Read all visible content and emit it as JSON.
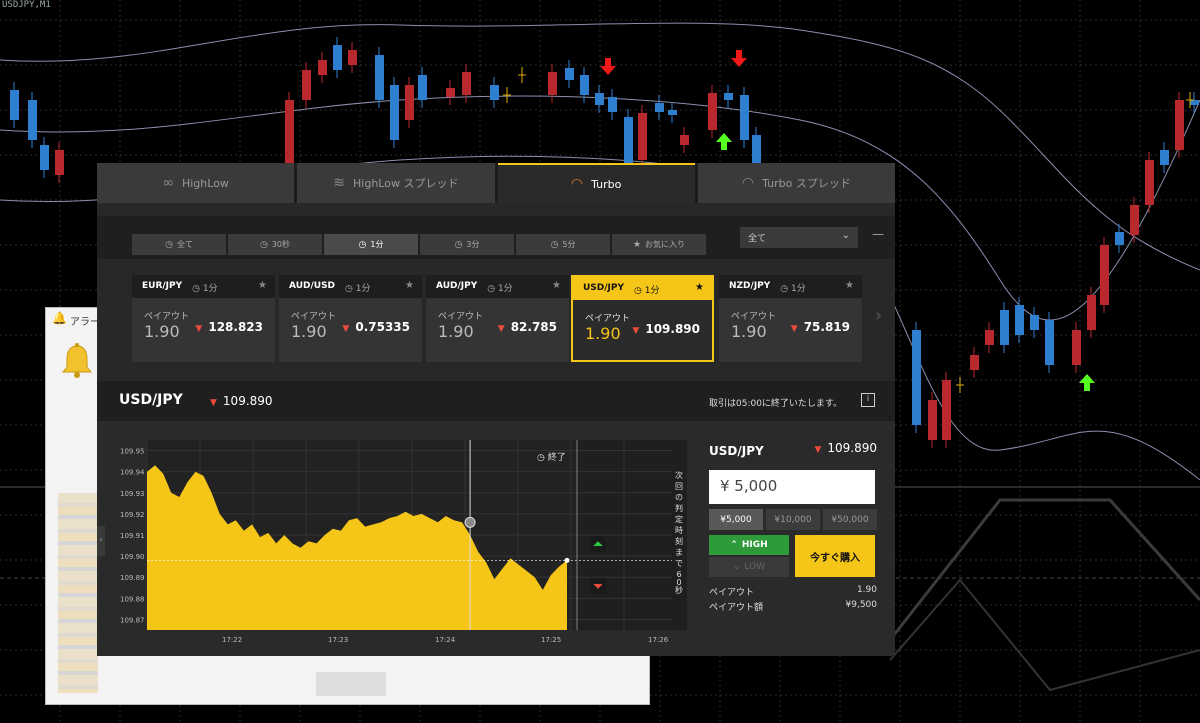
{
  "mt_chart": {
    "symbol_label": "USDJPY,M1"
  },
  "alert_window": {
    "title": "アラー"
  },
  "top_tabs": [
    {
      "label": "HighLow",
      "icon": "highlow-icon",
      "active": false
    },
    {
      "label": "HighLow スプレッド",
      "icon": "highlow-spread-icon",
      "active": false
    },
    {
      "label": "Turbo",
      "icon": "speedometer-icon",
      "active": true
    },
    {
      "label": "Turbo スプレッド",
      "icon": "speedometer-icon",
      "active": false
    }
  ],
  "filters": [
    {
      "label": "全て",
      "icon": "clock-icon"
    },
    {
      "label": "30秒",
      "icon": "clock-icon"
    },
    {
      "label": "1分",
      "icon": "clock-icon",
      "active": true
    },
    {
      "label": "3分",
      "icon": "clock-icon"
    },
    {
      "label": "5分",
      "icon": "clock-icon"
    },
    {
      "label": "お気に入り",
      "icon": "star-icon"
    }
  ],
  "asset_select": {
    "value": "全て"
  },
  "asset_cards": [
    {
      "pair": "EUR/JPY",
      "duration": "1分",
      "payout_label": "ペイアウト",
      "payout": "1.90",
      "price": "128.823"
    },
    {
      "pair": "AUD/USD",
      "duration": "1分",
      "payout_label": "ペイアウト",
      "payout": "1.90",
      "price": "0.75335"
    },
    {
      "pair": "AUD/JPY",
      "duration": "1分",
      "payout_label": "ペイアウト",
      "payout": "1.90",
      "price": "82.785"
    },
    {
      "pair": "USD/JPY",
      "duration": "1分",
      "payout_label": "ペイアウト",
      "payout": "1.90",
      "price": "109.890",
      "selected": true
    },
    {
      "pair": "NZD/JPY",
      "duration": "1分",
      "payout_label": "ペイアウト",
      "payout": "1.90",
      "price": "75.819"
    }
  ],
  "pair_bar": {
    "pair": "USD/JPY",
    "price": "109.890",
    "notice": "取引は05:00に終了いたします。"
  },
  "chart_data": {
    "type": "area",
    "y_ticks": [
      "109.95",
      "109.94",
      "109.93",
      "109.92",
      "109.91",
      "109.90",
      "109.89",
      "109.88",
      "109.87"
    ],
    "ylim": [
      109.865,
      109.955
    ],
    "x_ticks": [
      "17:22",
      "17:23",
      "17:24",
      "17:25",
      "17:26"
    ],
    "end_label": "終了",
    "countdown_text": "次回の判定時刻まで60秒",
    "current_price": 109.898,
    "series": [
      {
        "color": "#f5c518",
        "points": [
          [
            0,
            109.94
          ],
          [
            0.04,
            109.943
          ],
          [
            0.08,
            109.939
          ],
          [
            0.12,
            109.93
          ],
          [
            0.16,
            109.928
          ],
          [
            0.2,
            109.935
          ],
          [
            0.24,
            109.94
          ],
          [
            0.28,
            109.938
          ],
          [
            0.32,
            109.93
          ],
          [
            0.36,
            109.92
          ],
          [
            0.4,
            109.915
          ],
          [
            0.44,
            109.917
          ],
          [
            0.48,
            109.912
          ],
          [
            0.52,
            109.915
          ],
          [
            0.56,
            109.909
          ],
          [
            0.6,
            109.911
          ],
          [
            0.64,
            109.906
          ],
          [
            0.68,
            109.91
          ],
          [
            0.72,
            109.906
          ],
          [
            0.76,
            109.904
          ],
          [
            0.8,
            109.907
          ],
          [
            0.84,
            109.906
          ],
          [
            0.88,
            109.91
          ],
          [
            0.92,
            109.913
          ],
          [
            0.96,
            109.912
          ],
          [
            1.0,
            109.917
          ],
          [
            1.04,
            109.918
          ],
          [
            1.08,
            109.914
          ],
          [
            1.12,
            109.915
          ],
          [
            1.16,
            109.916
          ],
          [
            1.2,
            109.918
          ],
          [
            1.24,
            109.919
          ],
          [
            1.28,
            109.921
          ],
          [
            1.32,
            109.919
          ],
          [
            1.36,
            109.92
          ],
          [
            1.4,
            109.918
          ],
          [
            1.44,
            109.916
          ],
          [
            1.48,
            109.919
          ],
          [
            1.52,
            109.917
          ],
          [
            1.56,
            109.916
          ],
          [
            1.6,
            109.91
          ],
          [
            1.64,
            109.902
          ],
          [
            1.68,
            109.897
          ],
          [
            1.72,
            109.889
          ],
          [
            1.76,
            109.894
          ],
          [
            1.8,
            109.899
          ],
          [
            1.84,
            109.896
          ],
          [
            1.88,
            109.893
          ],
          [
            1.92,
            109.89
          ],
          [
            1.96,
            109.884
          ],
          [
            2.0,
            109.891
          ],
          [
            2.04,
            109.895
          ],
          [
            2.08,
            109.898
          ]
        ]
      }
    ]
  },
  "order": {
    "pair": "USD/JPY",
    "price": "109.890",
    "amount": "¥ 5,000",
    "presets": [
      "¥5,000",
      "¥10,000",
      "¥50,000"
    ],
    "high_label": "HIGH",
    "low_label": "LOW",
    "buy_label": "今すぐ購入",
    "payout_label": "ペイアウト",
    "payout_value": "1.90",
    "payout_amount_label": "ペイアウト額",
    "payout_amount_value": "¥9,500"
  }
}
